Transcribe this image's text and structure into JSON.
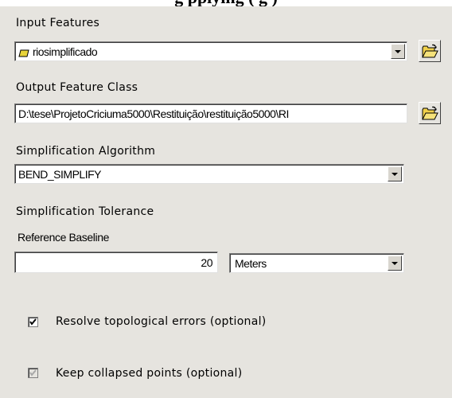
{
  "header_cutoff": "g       pplying (  g           )",
  "input_features": {
    "label": "Input Features",
    "value": "riosimplificado"
  },
  "output_feature_class": {
    "label": "Output Feature Class",
    "value": "D:\\tese\\ProjetoCriciuma5000\\Restituição\\restituição5000\\RI"
  },
  "algorithm": {
    "label": "Simplification Algorithm",
    "value": "BEND_SIMPLIFY"
  },
  "tolerance": {
    "label": "Simplification Tolerance",
    "sublabel": "Reference Baseline",
    "value": "20",
    "unit": "Meters"
  },
  "options": {
    "resolve_label": "Resolve topological errors (optional)",
    "resolve_checked": true,
    "keep_label": "Keep collapsed points (optional)",
    "keep_checked": true,
    "keep_disabled": true
  }
}
